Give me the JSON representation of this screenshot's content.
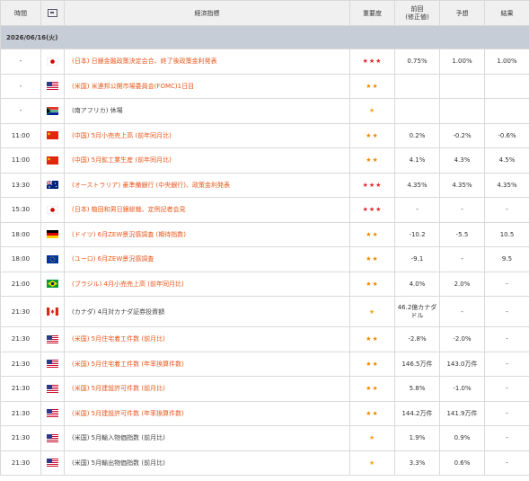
{
  "header": {
    "time": "時間",
    "flag_icon": "flag-icon",
    "indicator": "経済指標",
    "importance": "重要度",
    "previous_line1": "前回",
    "previous_line2": "(修正値)",
    "forecast": "予想",
    "result": "結果"
  },
  "date_label": "2026/06/16(火)",
  "rows": [
    {
      "time": "-",
      "country": "japan",
      "name": "(日本) 日銀金融政策決定会合、終了後政策金利発表",
      "highlight": true,
      "importance": "★★★",
      "level": "hi",
      "previous": "0.75%",
      "forecast": "1.00%",
      "result": "1.00%"
    },
    {
      "time": "-",
      "country": "us",
      "name": "(米国) 米連邦公開市場委員会(FOMC)1日目",
      "highlight": true,
      "importance": "★★",
      "level": "md",
      "previous": "",
      "forecast": "",
      "result": ""
    },
    {
      "time": "-",
      "country": "south-africa",
      "name": "(南アフリカ) 休場",
      "highlight": false,
      "importance": "★",
      "level": "lo",
      "previous": "",
      "forecast": "",
      "result": ""
    },
    {
      "time": "11:00",
      "country": "china",
      "name": "(中国) 5月小売売上高 (前年同月比)",
      "highlight": true,
      "importance": "★★",
      "level": "md",
      "previous": "0.2%",
      "forecast": "-0.2%",
      "result": "-0.6%"
    },
    {
      "time": "11:00",
      "country": "china",
      "name": "(中国) 5月鉱工業生産 (前年同月比)",
      "highlight": true,
      "importance": "★★",
      "level": "md",
      "previous": "4.1%",
      "forecast": "4.3%",
      "result": "4.5%"
    },
    {
      "time": "13:30",
      "country": "australia",
      "name": "(オーストラリア) 豪準備銀行 (中央銀行)、政策金利発表",
      "highlight": true,
      "importance": "★★★",
      "level": "hi",
      "previous": "4.35%",
      "forecast": "4.35%",
      "result": "4.35%"
    },
    {
      "time": "15:30",
      "country": "japan",
      "name": "(日本) 植田和男日銀総裁、定例記者会見",
      "highlight": true,
      "importance": "★★★",
      "level": "hi",
      "previous": "-",
      "forecast": "-",
      "result": "-"
    },
    {
      "time": "18:00",
      "country": "germany",
      "name": "(ドイツ) 6月ZEW景況感調査 (期待指数)",
      "highlight": true,
      "importance": "★★",
      "level": "md",
      "previous": "-10.2",
      "forecast": "-5.5",
      "result": "10.5"
    },
    {
      "time": "18:00",
      "country": "eu",
      "name": "(ユーロ) 6月ZEW景況感調査",
      "highlight": true,
      "importance": "★★",
      "level": "md",
      "previous": "-9.1",
      "forecast": "-",
      "result": "9.5"
    },
    {
      "time": "21:00",
      "country": "brazil",
      "name": "(ブラジル) 4月小売売上高 (前年同月比)",
      "highlight": true,
      "importance": "★★",
      "level": "md",
      "previous": "4.0%",
      "forecast": "2.0%",
      "result": "-"
    },
    {
      "time": "21:30",
      "country": "canada",
      "name": "(カナダ) 4月対カナダ証券投資額",
      "highlight": false,
      "importance": "★",
      "level": "lo",
      "previous": "46.2億カナダドル",
      "forecast": "-",
      "result": "-"
    },
    {
      "time": "21:30",
      "country": "us",
      "name": "(米国) 5月住宅着工件数 (前月比)",
      "highlight": true,
      "importance": "★★",
      "level": "md",
      "previous": "-2.8%",
      "forecast": "-2.0%",
      "result": "-"
    },
    {
      "time": "21:30",
      "country": "us",
      "name": "(米国) 5月住宅着工件数 (年率換算件数)",
      "highlight": true,
      "importance": "★★",
      "level": "md",
      "previous": "146.5万件",
      "forecast": "143.0万件",
      "result": "-"
    },
    {
      "time": "21:30",
      "country": "us",
      "name": "(米国) 5月建設許可件数 (前月比)",
      "highlight": true,
      "importance": "★★",
      "level": "md",
      "previous": "5.8%",
      "forecast": "-1.0%",
      "result": "-"
    },
    {
      "time": "21:30",
      "country": "us",
      "name": "(米国) 5月建設許可件数 (年率換算件数)",
      "highlight": true,
      "importance": "★★",
      "level": "md",
      "previous": "144.2万件",
      "forecast": "141.9万件",
      "result": "-"
    },
    {
      "time": "21:30",
      "country": "us",
      "name": "(米国) 5月輸入物価指数 (前月比)",
      "highlight": false,
      "importance": "★",
      "level": "lo",
      "previous": "1.9%",
      "forecast": "0.9%",
      "result": "-"
    },
    {
      "time": "21:30",
      "country": "us",
      "name": "(米国) 5月輸出物価指数 (前月比)",
      "highlight": false,
      "importance": "★",
      "level": "lo",
      "previous": "3.3%",
      "forecast": "0.6%",
      "result": "-"
    }
  ]
}
